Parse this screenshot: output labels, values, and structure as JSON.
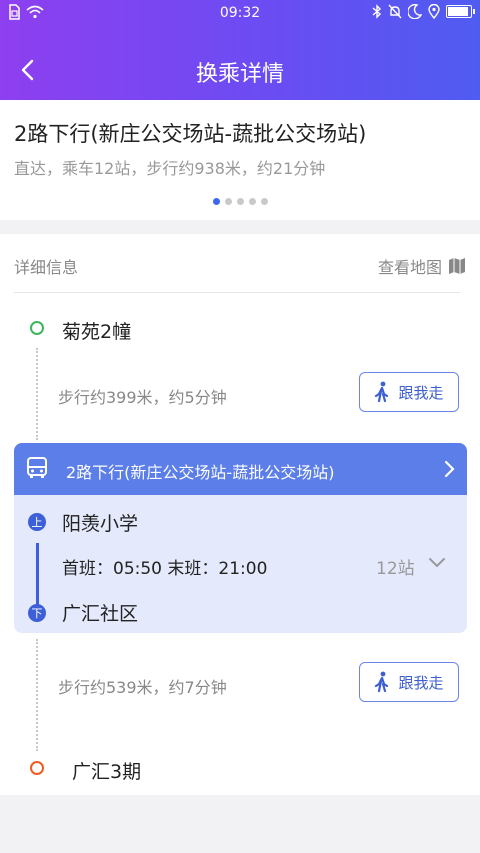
{
  "status_bar": {
    "time": "09:32",
    "left_icons": [
      "sim-icon",
      "wifi-icon"
    ],
    "right_icons": [
      "bluetooth-icon",
      "mute-icon",
      "moon-icon",
      "location-icon",
      "battery-icon"
    ]
  },
  "header": {
    "title": "换乘详情",
    "back_icon": "chevron-left-icon",
    "gradient": [
      "#8e3ff0",
      "#4f5cf2"
    ]
  },
  "summary": {
    "route_title": "2路下行(新庄公交场站-蔬批公交场站)",
    "route_subtitle": "直达，乘车12站，步行约938米，约21分钟",
    "pager": {
      "count": 5,
      "active": 0
    }
  },
  "detail": {
    "section_label": "详细信息",
    "map_link": "查看地图",
    "start_stop": "菊苑2幢",
    "walk1": {
      "text": "步行约399米，约5分钟",
      "button": "跟我走"
    },
    "bus": {
      "line_label": "2路下行(新庄公交场站-蔬批公交场站)",
      "board_badge": "上",
      "alight_badge": "下",
      "board_stop": "阳羡小学",
      "schedule": "首班：05:50 末班：21:00",
      "stop_count": "12站",
      "alight_stop": "广汇社区"
    },
    "walk2": {
      "text": "步行约539米，约7分钟",
      "button": "跟我走"
    },
    "end_stop": "广汇3期"
  },
  "colors": {
    "accent": "#3d67f1",
    "bus_header": "#5b7ee8",
    "bus_card_bg": "#e4eafc",
    "start_green": "#3fb55a",
    "end_orange": "#f25a21"
  }
}
